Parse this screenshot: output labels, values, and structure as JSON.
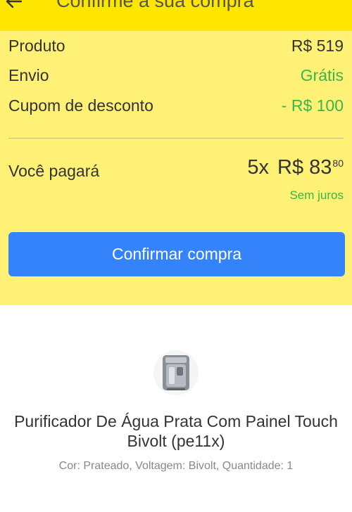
{
  "header": {
    "title": "Confirme a sua compra",
    "back_icon": "arrow-left-icon",
    "background": "#ffe600"
  },
  "summary": {
    "background": "#fff176",
    "rows": [
      {
        "label": "Produto",
        "value": "R$ 519"
      },
      {
        "label": "Envio",
        "value": "Grátis"
      },
      {
        "label": "Cupom de desconto",
        "value": "- R$ 100"
      }
    ],
    "total": {
      "label": "Você pagará",
      "installments": "5x",
      "amount": "R$ 83",
      "cents": "80",
      "note": "Sem juros"
    },
    "confirm_label": "Confirmar compra",
    "accent_color": "#3483fa",
    "positive_color": "#39b54a"
  },
  "product": {
    "image_icon": "water-purifier-icon",
    "title": "Purificador De Água Prata Com Painel Touch Bivolt (pe11x)",
    "details": "Cor: Prateado, Voltagem: Bivolt, Quantidade: 1"
  }
}
